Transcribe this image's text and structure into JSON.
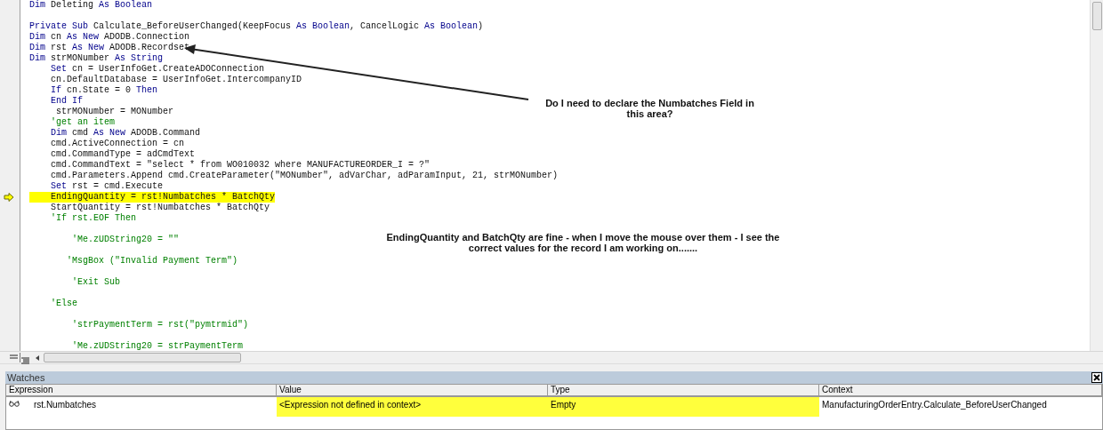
{
  "code_editor": {
    "lines": [
      {
        "current": false,
        "segments": [
          {
            "kind": "kw",
            "text": "Dim"
          },
          {
            "kind": "code",
            "text": " Deleting "
          },
          {
            "kind": "kw",
            "text": "As Boolean"
          }
        ]
      },
      {
        "current": false
      },
      {
        "current": false,
        "segments": [
          {
            "kind": "kw",
            "text": "Private Sub"
          },
          {
            "kind": "code",
            "text": " Calculate_BeforeUserChanged(KeepFocus "
          },
          {
            "kind": "kw",
            "text": "As Boolean"
          },
          {
            "kind": "code",
            "text": ", CancelLogic "
          },
          {
            "kind": "kw",
            "text": "As Boolean"
          },
          {
            "kind": "code",
            "text": ")"
          }
        ]
      },
      {
        "current": false,
        "segments": [
          {
            "kind": "kw",
            "text": "Dim"
          },
          {
            "kind": "code",
            "text": " cn "
          },
          {
            "kind": "kw",
            "text": "As New"
          },
          {
            "kind": "code",
            "text": " ADODB.Connection"
          }
        ]
      },
      {
        "current": false,
        "segments": [
          {
            "kind": "kw",
            "text": "Dim"
          },
          {
            "kind": "code",
            "text": " rst "
          },
          {
            "kind": "kw",
            "text": "As New"
          },
          {
            "kind": "code",
            "text": " ADODB.Recordset"
          }
        ]
      },
      {
        "current": false,
        "segments": [
          {
            "kind": "kw",
            "text": "Dim"
          },
          {
            "kind": "code",
            "text": " strMONumber "
          },
          {
            "kind": "kw",
            "text": "As String"
          }
        ]
      },
      {
        "current": false,
        "segments": [
          {
            "kind": "kw",
            "text": "    Set"
          },
          {
            "kind": "code",
            "text": " cn = UserInfoGet.CreateADOConnection"
          }
        ]
      },
      {
        "current": false,
        "segments": [
          {
            "kind": "code",
            "text": "    cn.DefaultDatabase = UserInfoGet.IntercompanyID"
          }
        ]
      },
      {
        "current": false,
        "segments": [
          {
            "kind": "kw",
            "text": "    If"
          },
          {
            "kind": "code",
            "text": " cn.State = 0 "
          },
          {
            "kind": "kw",
            "text": "Then"
          }
        ]
      },
      {
        "current": false,
        "segments": [
          {
            "kind": "kw",
            "text": "    End If"
          }
        ]
      },
      {
        "current": false,
        "segments": [
          {
            "kind": "code",
            "text": "     strMONumber = MONumber"
          }
        ]
      },
      {
        "current": false,
        "segments": [
          {
            "kind": "comment",
            "text": "    'get an item"
          }
        ]
      },
      {
        "current": false,
        "segments": [
          {
            "kind": "kw",
            "text": "    Dim"
          },
          {
            "kind": "code",
            "text": " cmd "
          },
          {
            "kind": "kw",
            "text": "As New"
          },
          {
            "kind": "code",
            "text": " ADODB.Command"
          }
        ]
      },
      {
        "current": false,
        "segments": [
          {
            "kind": "code",
            "text": "    cmd.ActiveConnection = cn"
          }
        ]
      },
      {
        "current": false,
        "segments": [
          {
            "kind": "code",
            "text": "    cmd.CommandType = adCmdText"
          }
        ]
      },
      {
        "current": false,
        "segments": [
          {
            "kind": "code",
            "text": "    cmd.CommandText = \"select * from WO010032 where MANUFACTUREORDER_I = ?\""
          }
        ]
      },
      {
        "current": false,
        "segments": [
          {
            "kind": "code",
            "text": "    cmd.Parameters.Append cmd.CreateParameter(\"MONumber\", adVarChar, adParamInput, 21, strMONumber)"
          }
        ]
      },
      {
        "current": false,
        "segments": [
          {
            "kind": "kw",
            "text": "    Set"
          },
          {
            "kind": "code",
            "text": " rst = cmd.Execute"
          }
        ]
      },
      {
        "current": true,
        "segments": [
          {
            "kind": "code",
            "text": "    EndingQuantity = rst!Numbatches * BatchQty"
          }
        ]
      },
      {
        "current": false,
        "segments": [
          {
            "kind": "code",
            "text": "    StartQuantity = rst!Numbatches * BatchQty"
          }
        ]
      },
      {
        "current": false,
        "segments": [
          {
            "kind": "comment",
            "text": "    'If rst.EOF Then"
          }
        ]
      },
      {
        "current": false
      },
      {
        "current": false,
        "segments": [
          {
            "kind": "comment",
            "text": "        'Me.zUDString20 = \"\""
          }
        ]
      },
      {
        "current": false
      },
      {
        "current": false,
        "segments": [
          {
            "kind": "comment",
            "text": "       'MsgBox (\"Invalid Payment Term\")"
          }
        ]
      },
      {
        "current": false
      },
      {
        "current": false,
        "segments": [
          {
            "kind": "comment",
            "text": "        'Exit Sub"
          }
        ]
      },
      {
        "current": false
      },
      {
        "current": false,
        "segments": [
          {
            "kind": "comment",
            "text": "    'Else"
          }
        ]
      },
      {
        "current": false
      },
      {
        "current": false,
        "segments": [
          {
            "kind": "comment",
            "text": "        'strPaymentTerm = rst(\"pymtrmid\")"
          }
        ]
      },
      {
        "current": false
      },
      {
        "current": false,
        "segments": [
          {
            "kind": "comment",
            "text": "        'Me.zUDString20 = strPaymentTerm"
          }
        ]
      }
    ],
    "annotations": [
      {
        "kind": "arrow-note",
        "text": "Do I need to declare the Numbatches Field in this area?"
      },
      {
        "kind": "note",
        "text": "EndingQuantity and BatchQty are fine - when I move the mouse over them - I see the correct values for the record I am working on......."
      }
    ]
  },
  "watches": {
    "title": "Watches",
    "columns": [
      "Expression",
      "Value",
      "Type",
      "Context"
    ],
    "rows": [
      {
        "cells": [
          {
            "text": "rst.Numbatches",
            "highlighted": false
          },
          {
            "text": "<Expression not defined in context>",
            "highlighted": true
          },
          {
            "text": "Empty",
            "highlighted": true
          },
          {
            "text": "ManufacturingOrderEntry.Calculate_BeforeUserChanged",
            "highlighted": false
          }
        ]
      }
    ]
  }
}
